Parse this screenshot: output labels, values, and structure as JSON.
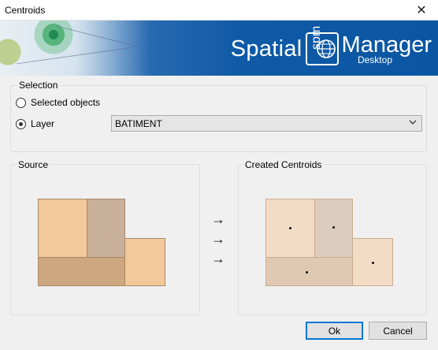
{
  "window": {
    "title": "Centroids",
    "close_glyph": "✕"
  },
  "banner": {
    "logo_spatial": "Spatial",
    "logo_spm": "spm",
    "logo_manager": "Manager",
    "logo_desktop": "Desktop"
  },
  "selection": {
    "legend": "Selection",
    "options": [
      {
        "label": "Selected objects",
        "checked": false
      },
      {
        "label": "Layer",
        "checked": true
      }
    ],
    "layer_value": "BATIMENT",
    "dropdown_icon": "chevron-down-icon"
  },
  "source": {
    "legend": "Source"
  },
  "arrows": [
    "→",
    "→",
    "→"
  ],
  "created": {
    "legend": "Created Centroids"
  },
  "buttons": {
    "ok": "Ok",
    "cancel": "Cancel"
  },
  "colors": {
    "source_light": "#f2c99b",
    "source_mid": "#c9b09a",
    "source_dark": "#cda77f",
    "created_light": "#f3dcc6",
    "created_mid": "#dcccbd",
    "created_dark": "#dfc9b2",
    "banner_blue": "#0b56a3"
  }
}
